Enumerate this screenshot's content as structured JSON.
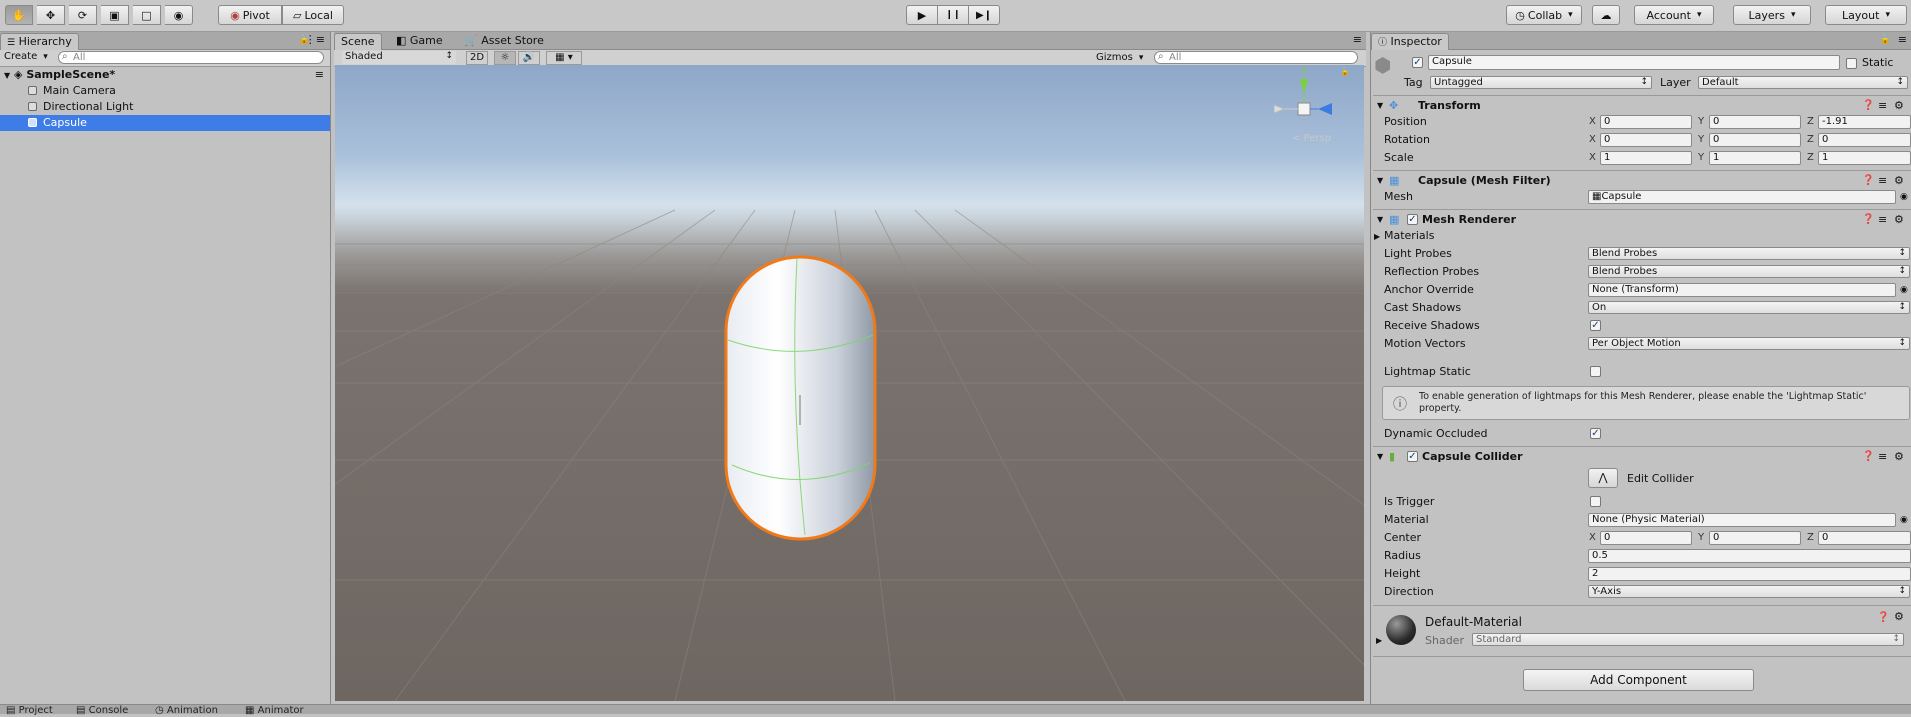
{
  "toolbar": {
    "pivot_label": "Pivot",
    "local_label": "Local",
    "collab_label": "Collab",
    "account_label": "Account",
    "layers_label": "Layers",
    "layout_label": "Layout",
    "tools": [
      "hand-icon",
      "move-icon",
      "rotate-icon",
      "scale-icon",
      "rect-icon",
      "transform-icon"
    ],
    "play_icon": "▶",
    "pause_icon": "❙❙",
    "step_icon": "▶❙"
  },
  "hierarchy": {
    "tab_label": "Hierarchy",
    "create_label": "Create",
    "search_placeholder": "All",
    "scene_name": "SampleScene*",
    "items": [
      {
        "label": "Main Camera"
      },
      {
        "label": "Directional Light"
      },
      {
        "label": "Capsule"
      }
    ]
  },
  "scene": {
    "tabs": [
      "Scene",
      "Game",
      "Asset Store"
    ],
    "shading_mode": "Shaded",
    "mode_2d": "2D",
    "gizmos_label": "Gizmos",
    "search_placeholder": "All",
    "persp_label": "< Persp",
    "axis_y": "y",
    "axis_x": "x"
  },
  "inspector": {
    "tab_label": "Inspector",
    "object_name": "Capsule",
    "static_label": "Static",
    "tag_label": "Tag",
    "tag_value": "Untagged",
    "layer_label": "Layer",
    "layer_value": "Default",
    "transform": {
      "title": "Transform",
      "position_label": "Position",
      "rotation_label": "Rotation",
      "scale_label": "Scale",
      "position": {
        "x": "0",
        "y": "0",
        "z": "-1.91"
      },
      "rotation": {
        "x": "0",
        "y": "0",
        "z": "0"
      },
      "scale": {
        "x": "1",
        "y": "1",
        "z": "1"
      }
    },
    "mesh_filter": {
      "title": "Capsule (Mesh Filter)",
      "mesh_label": "Mesh",
      "mesh_value": "Capsule"
    },
    "mesh_renderer": {
      "title": "Mesh Renderer",
      "materials_label": "Materials",
      "light_probes_label": "Light Probes",
      "light_probes_value": "Blend Probes",
      "reflection_probes_label": "Reflection Probes",
      "reflection_probes_value": "Blend Probes",
      "anchor_override_label": "Anchor Override",
      "anchor_override_value": "None (Transform)",
      "cast_shadows_label": "Cast Shadows",
      "cast_shadows_value": "On",
      "receive_shadows_label": "Receive Shadows",
      "motion_vectors_label": "Motion Vectors",
      "motion_vectors_value": "Per Object Motion",
      "lightmap_static_label": "Lightmap Static",
      "help_text": "To enable generation of lightmaps for this Mesh Renderer, please enable the 'Lightmap Static' property.",
      "dynamic_occluded_label": "Dynamic Occluded"
    },
    "capsule_collider": {
      "title": "Capsule Collider",
      "edit_collider_label": "Edit Collider",
      "is_trigger_label": "Is Trigger",
      "material_label": "Material",
      "material_value": "None (Physic Material)",
      "center_label": "Center",
      "center": {
        "x": "0",
        "y": "0",
        "z": "0"
      },
      "radius_label": "Radius",
      "radius_value": "0.5",
      "height_label": "Height",
      "height_value": "2",
      "direction_label": "Direction",
      "direction_value": "Y-Axis"
    },
    "material": {
      "name": "Default-Material",
      "shader_label": "Shader",
      "shader_value": "Standard"
    },
    "add_component_label": "Add Component"
  },
  "bottom_tabs": [
    "Project",
    "Console",
    "Animation",
    "Animator"
  ],
  "colors": {
    "selection": "#3e7de7",
    "outline": "#f07a1a",
    "axis_y": "#7bd13a",
    "axis_x": "#e53b2f",
    "axis_z": "#3a7ce0"
  }
}
